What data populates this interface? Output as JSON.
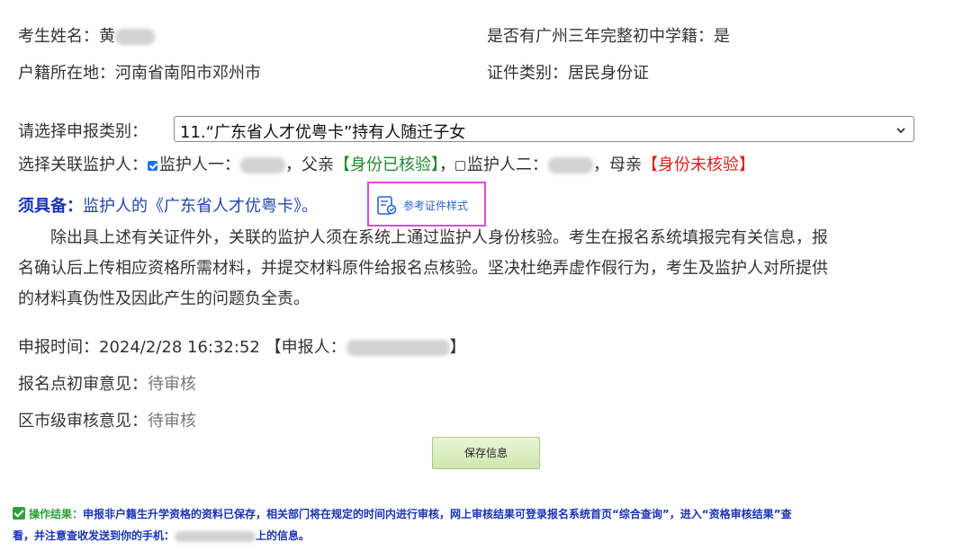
{
  "applicant": {
    "name_label": "考生姓名：",
    "name_value_prefix": "黄",
    "household_label": "户籍所在地：",
    "household_value": "河南省南阳市邓州市",
    "school_status": "是否有广州三年完整初中学籍：是",
    "id_type": "证件类别：居民身份证"
  },
  "category": {
    "label": "请选择申报类别：",
    "selected": "11.“广东省人才优粤卡”持有人随迁子女"
  },
  "guardians": {
    "label": "选择关联监护人：",
    "g1_label": "监护人一：",
    "g1_relation": "，父亲",
    "g1_status": "【身份已核验】",
    "separator": "，",
    "g2_label": "监护人二：",
    "g2_relation": "，母亲",
    "g2_status": "【身份未核验】"
  },
  "required": {
    "label": "须具备：",
    "text": "监护人的《广东省人才优粤卡》。",
    "sample_button": "参考证件样式"
  },
  "notice": {
    "lines": [
      "　　除出具上述有关证件外，关联的监护人须在系统上通过监护人身份核验。考生在报名系统填报完有关信息，报",
      "名确认后上传相应资格所需材料，并提交材料原件给报名点核验。坚决杜绝弄虚作假行为，考生及监护人对所提供",
      "的材料真伪性及因此产生的问题负全责。"
    ]
  },
  "submission": {
    "time_label": "申报时间：",
    "time_value": "2024/2/28 16:32:52",
    "applicant_open": "【申报人：",
    "applicant_close": "】",
    "preliminary_label": "报名点初审意见：",
    "preliminary_value": "待审核",
    "district_label": "区市级审核意见：",
    "district_value": "待审核"
  },
  "save_button": "保存信息",
  "result": {
    "title": "操作结果：",
    "line1": "申报非户籍生升学资格的资料已保存，相关部门将在规定的时间内进行审核，网上审核结果可登录报名系统首页“综合查询”，进入“资格审核结果”查",
    "line2_a": "看，并注意查收发送到你的手机：",
    "line2_b": "上的信息。"
  },
  "colors": {
    "verified": "#1e8b2e",
    "unverified": "#e21d1d",
    "link_blue": "#2247a8",
    "result_blue": "#1a34b8"
  }
}
